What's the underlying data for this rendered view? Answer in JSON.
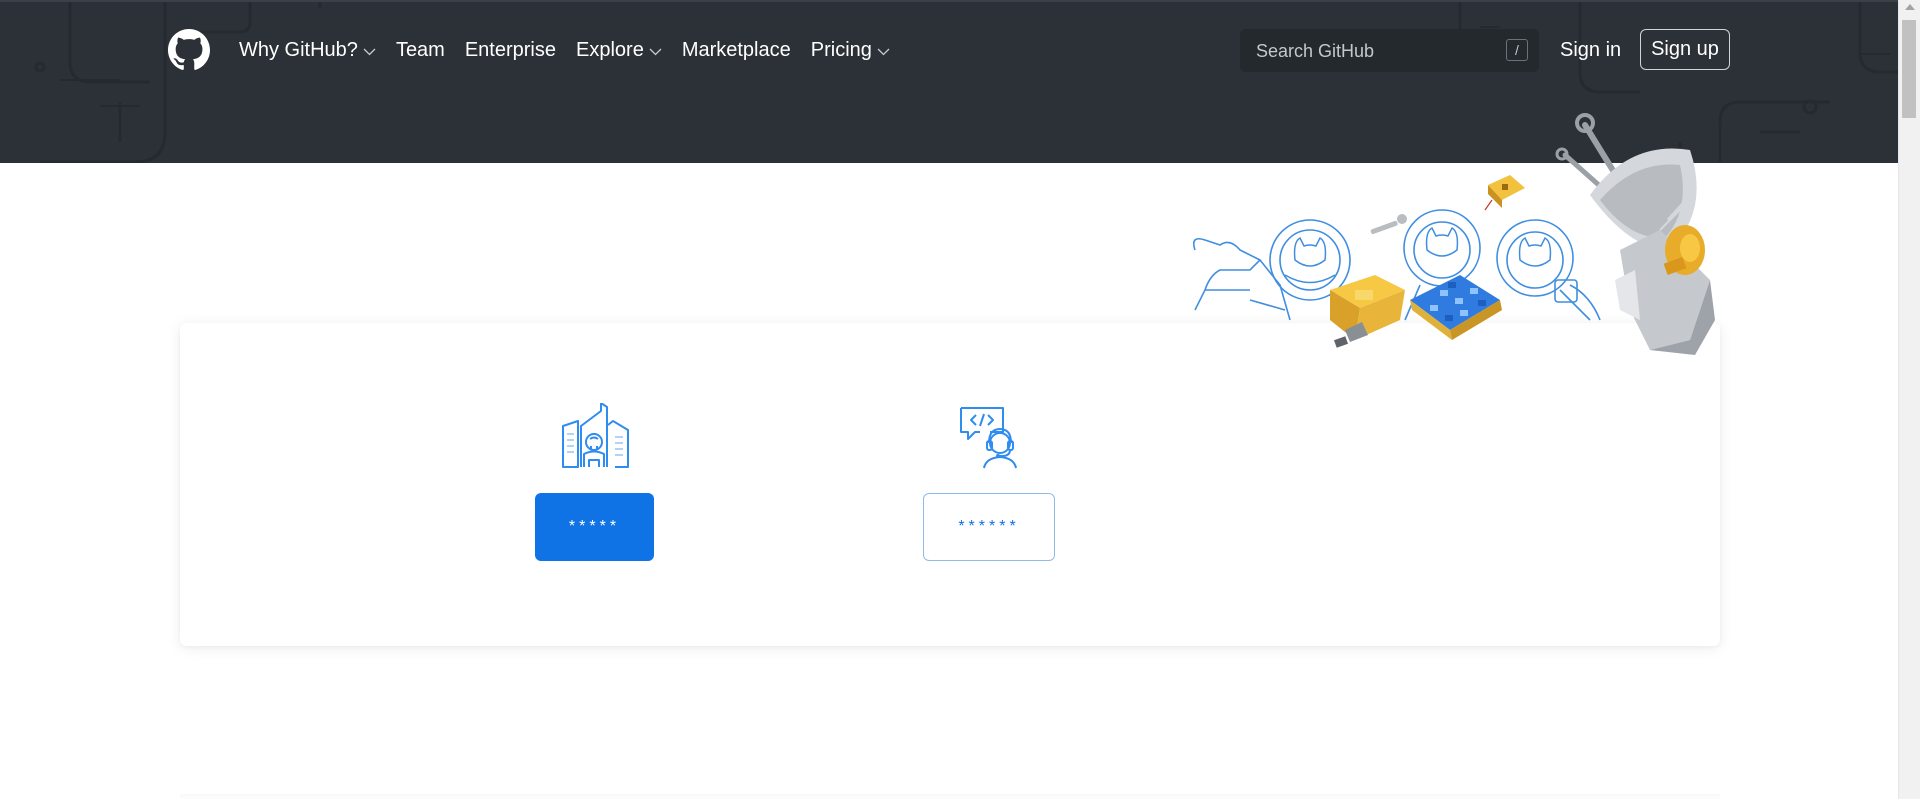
{
  "header": {
    "nav": [
      {
        "label": "Why GitHub?",
        "has_caret": true
      },
      {
        "label": "Team",
        "has_caret": false
      },
      {
        "label": "Enterprise",
        "has_caret": false
      },
      {
        "label": "Explore",
        "has_caret": true
      },
      {
        "label": "Marketplace",
        "has_caret": false
      },
      {
        "label": "Pricing",
        "has_caret": true
      }
    ],
    "search": {
      "placeholder": "Search GitHub",
      "shortcut": "/"
    },
    "signin_label": "Sign in",
    "signup_label": "Sign up"
  },
  "card": {
    "options": [
      {
        "icon": "enterprise-building-icon",
        "button_label": "*****"
      },
      {
        "icon": "developer-support-icon",
        "button_label": "******"
      }
    ]
  },
  "colors": {
    "header_bg": "#2b3137",
    "primary_blue": "#0f72e5",
    "icon_blue": "#2f8cf0"
  }
}
